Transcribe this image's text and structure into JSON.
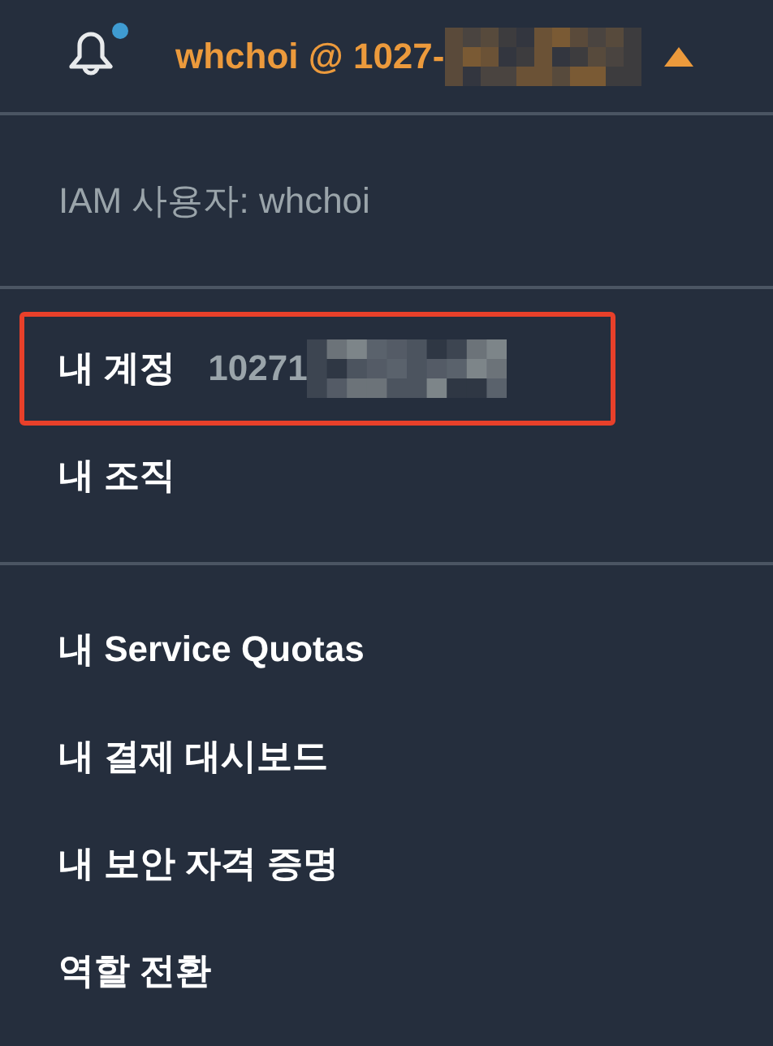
{
  "header": {
    "user_label": "whchoi @ 1027-",
    "redacted": true,
    "has_notification": true,
    "menu_expanded": true
  },
  "sections": [
    {
      "items": [
        {
          "kind": "info",
          "label": "IAM 사용자: whchoi"
        }
      ]
    },
    {
      "items": [
        {
          "kind": "account",
          "label": "내 계정",
          "value": "10271",
          "redacted": true,
          "highlighted": true
        },
        {
          "kind": "link",
          "label": "내 조직"
        }
      ]
    },
    {
      "items": [
        {
          "kind": "link",
          "label": "내 Service Quotas"
        },
        {
          "kind": "link",
          "label": "내 결제 대시보드"
        },
        {
          "kind": "link",
          "label": "내 보안 자격 증명"
        },
        {
          "kind": "link",
          "label": "역할 전환"
        }
      ]
    }
  ]
}
